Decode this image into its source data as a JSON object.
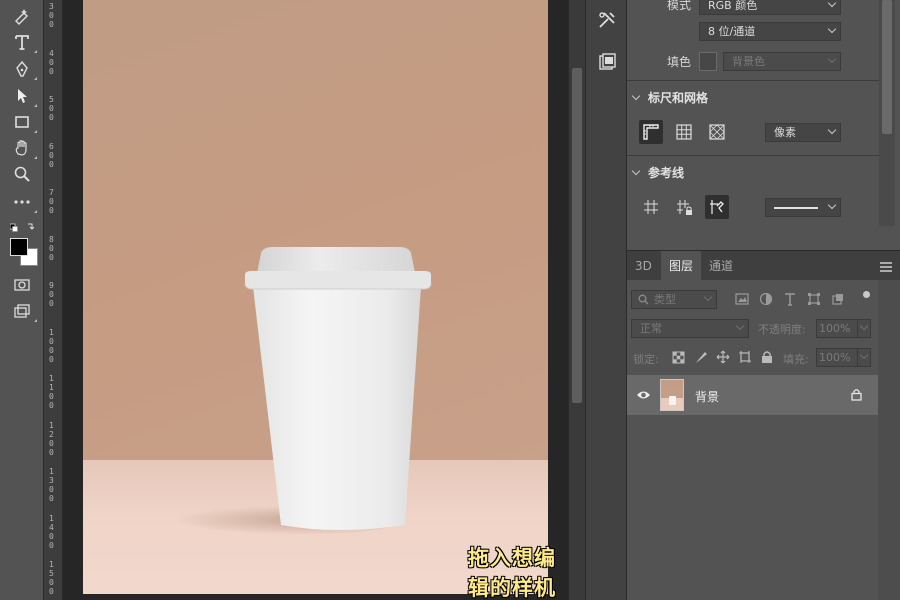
{
  "toolbar": {
    "tools": [
      {
        "name": "healing-brush-icon"
      },
      {
        "name": "type-tool-icon",
        "glyph": "T"
      },
      {
        "name": "pen-tool-icon"
      },
      {
        "name": "path-selection-icon"
      },
      {
        "name": "rectangle-tool-icon"
      },
      {
        "name": "hand-tool-icon"
      },
      {
        "name": "zoom-tool-icon"
      },
      {
        "name": "more-tools-icon",
        "glyph": "•••"
      },
      {
        "name": "quick-mask-icon"
      },
      {
        "name": "screen-mode-icon"
      }
    ],
    "foreground_color": "#000000",
    "background_color": "#ffffff"
  },
  "ruler": {
    "labels": [
      "3\n0\n0",
      "4\n0\n0",
      "5\n0\n0",
      "6\n0\n0",
      "7\n0\n0",
      "8\n0\n0",
      "9\n0\n0",
      "1\n0\n0\n0",
      "1\n1\n0\n0",
      "1\n2\n0\n0",
      "1\n3\n0\n0",
      "1\n4\n0\n0",
      "1\n5\n0\n0"
    ]
  },
  "canvas": {
    "wall_color": "#c39d86",
    "table_color": "#efd4c7",
    "cup_color": "#f2f2f2"
  },
  "caption": {
    "text": "拖入想编辑的样机"
  },
  "properties": {
    "mode_label": "模式",
    "mode_value": "RGB 颜色",
    "depth_value": "8 位/通道",
    "fill_label": "填色",
    "fill_value": "背景色",
    "rulers_grid_title": "标尺和网格",
    "units_value": "像素",
    "guides_title": "参考线"
  },
  "layers": {
    "tabs": [
      "3D",
      "图层",
      "通道"
    ],
    "active_tab": "图层",
    "filter_label": "类型",
    "blend_mode": "正常",
    "opacity_label": "不透明度:",
    "opacity_value": "100%",
    "lock_label": "锁定:",
    "fill_label": "填充:",
    "fill_value": "100%",
    "items": [
      {
        "name": "背景",
        "visible": true,
        "locked": true
      }
    ]
  }
}
